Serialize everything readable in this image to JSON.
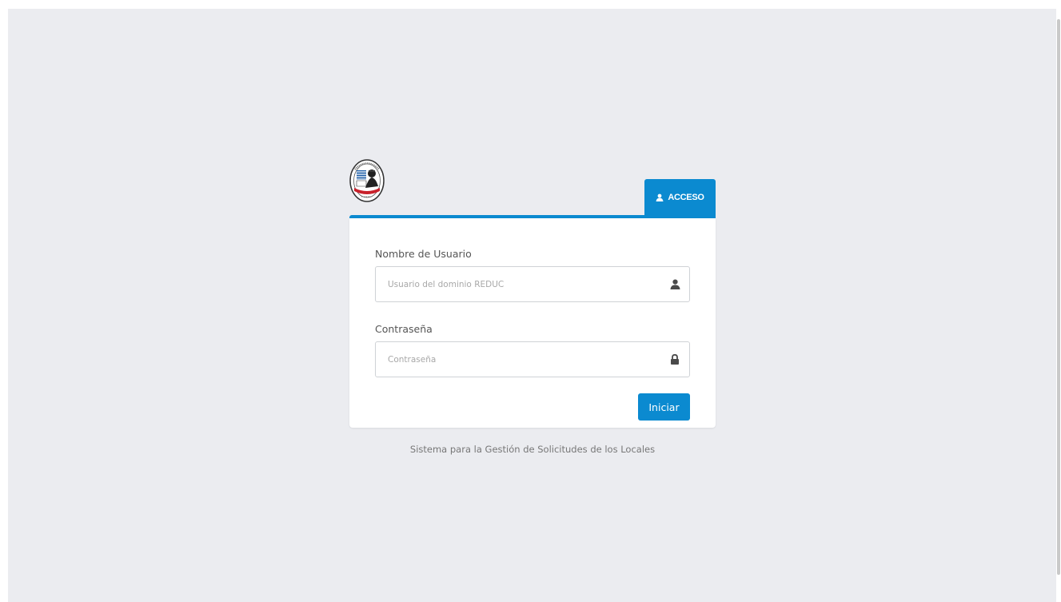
{
  "login": {
    "tab_label": "ACCESO",
    "username_label": "Nombre de Usuario",
    "username_placeholder": "Usuario del dominio REDUC",
    "username_value": "",
    "password_label": "Contraseña",
    "password_placeholder": "Contraseña",
    "password_value": "",
    "submit_label": "Iniciar"
  },
  "footer": {
    "text": "Sistema para la Gestión de Solicitudes de los Locales"
  },
  "icons": {
    "tab": "user-icon",
    "username": "user-icon",
    "password": "lock-icon"
  },
  "colors": {
    "accent": "#0b8ad0",
    "background": "#ebecf0",
    "card": "#ffffff",
    "text": "#555555",
    "muted": "#777777"
  }
}
